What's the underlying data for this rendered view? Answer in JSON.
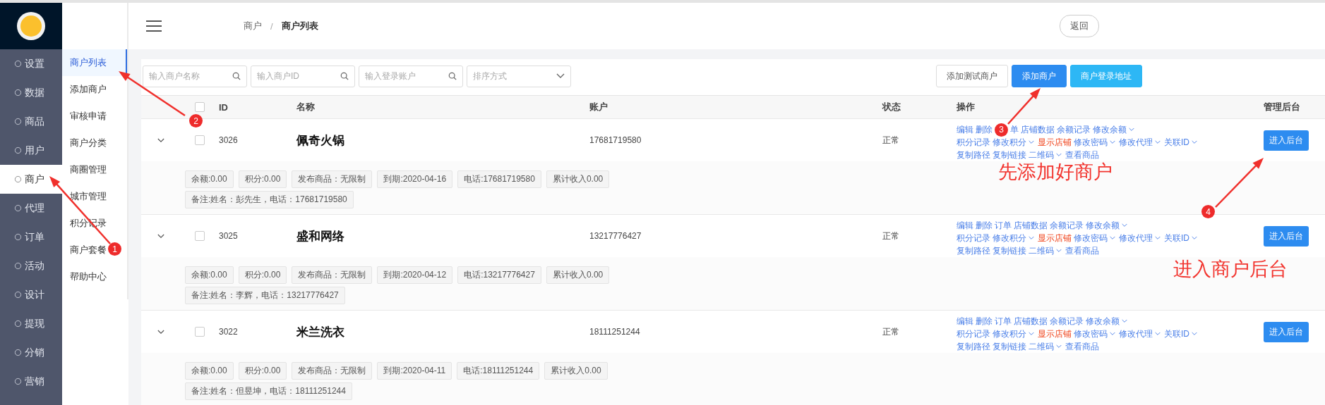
{
  "sidebar": {
    "items": [
      {
        "label": "设置",
        "selected": false
      },
      {
        "label": "数据",
        "selected": false
      },
      {
        "label": "商品",
        "selected": false
      },
      {
        "label": "用户",
        "selected": false
      },
      {
        "label": "商户",
        "selected": true
      },
      {
        "label": "代理",
        "selected": false
      },
      {
        "label": "订单",
        "selected": false
      },
      {
        "label": "活动",
        "selected": false
      },
      {
        "label": "设计",
        "selected": false
      },
      {
        "label": "提现",
        "selected": false
      },
      {
        "label": "分销",
        "selected": false
      },
      {
        "label": "营销",
        "selected": false
      }
    ]
  },
  "submenu": {
    "items": [
      {
        "label": "商户列表",
        "selected": true
      },
      {
        "label": "添加商户",
        "selected": false
      },
      {
        "label": "审核申请",
        "selected": false
      },
      {
        "label": "商户分类",
        "selected": false
      },
      {
        "label": "商圈管理",
        "selected": false
      },
      {
        "label": "城市管理",
        "selected": false
      },
      {
        "label": "积分记录",
        "selected": false
      },
      {
        "label": "商户套餐",
        "selected": false
      },
      {
        "label": "帮助中心",
        "selected": false
      }
    ]
  },
  "header": {
    "breadcrumb": [
      "商户",
      "商户列表"
    ],
    "separator": "/",
    "back_button": "返回"
  },
  "filters": [
    {
      "placeholder": "输入商户名称",
      "kind": "search"
    },
    {
      "placeholder": "输入商户ID",
      "kind": "search"
    },
    {
      "placeholder": "输入登录账户",
      "kind": "search"
    },
    {
      "placeholder": "排序方式",
      "kind": "select"
    }
  ],
  "toolbar_buttons": [
    {
      "label": "添加测试商户",
      "kind": "default"
    },
    {
      "label": "添加商户",
      "kind": "primary"
    },
    {
      "label": "商户登录地址",
      "kind": "info"
    }
  ],
  "table": {
    "columns": [
      "ID",
      "名称",
      "账户",
      "状态",
      "操作",
      "管理后台"
    ],
    "select_all_checked": false,
    "rows": [
      {
        "expanded": true,
        "checked": false,
        "id": "3026",
        "name": "佩奇火锅",
        "account": "17681719580",
        "status": "正常",
        "admin_button": "进入后台",
        "actions": [
          [
            {
              "kind": "link",
              "text": "编辑",
              "dropdown": false,
              "highlight": false
            },
            {
              "kind": "link",
              "text": "删除",
              "dropdown": false,
              "highlight": false
            },
            {
              "kind": "marker",
              "text": "3"
            },
            {
              "kind": "link",
              "text": "单",
              "dropdown": false,
              "highlight": false
            },
            {
              "kind": "link",
              "text": "店铺数据",
              "dropdown": false,
              "highlight": false
            },
            {
              "kind": "link",
              "text": "余额记录",
              "dropdown": false,
              "highlight": false
            },
            {
              "kind": "link",
              "text": "修改余额",
              "dropdown": true,
              "highlight": false
            }
          ],
          [
            {
              "kind": "link",
              "text": "积分记录",
              "dropdown": false,
              "highlight": false
            },
            {
              "kind": "link",
              "text": "修改积分",
              "dropdown": true,
              "highlight": false
            },
            {
              "kind": "link",
              "text": "显示店铺",
              "dropdown": false,
              "highlight": true
            },
            {
              "kind": "link",
              "text": "修改密码",
              "dropdown": true,
              "highlight": false
            },
            {
              "kind": "link",
              "text": "修改代理",
              "dropdown": true,
              "highlight": false
            },
            {
              "kind": "link",
              "text": "关联ID",
              "dropdown": true,
              "highlight": false
            }
          ],
          [
            {
              "kind": "link",
              "text": "复制路径",
              "dropdown": false,
              "highlight": false
            },
            {
              "kind": "link",
              "text": "复制链接",
              "dropdown": false,
              "highlight": false
            },
            {
              "kind": "link",
              "text": "二维码",
              "dropdown": true,
              "highlight": false
            },
            {
              "kind": "link",
              "text": "查看商品",
              "dropdown": false,
              "highlight": false
            }
          ]
        ],
        "tags": [
          "余额:0.00",
          "积分:0.00",
          "发布商品：无限制",
          "到期:2020-04-16",
          "电话:17681719580",
          "累计收入0.00"
        ],
        "remark": "备注:姓名：彭先生，电话：17681719580"
      },
      {
        "expanded": true,
        "checked": false,
        "id": "3025",
        "name": "盛和网络",
        "account": "13217776427",
        "status": "正常",
        "admin_button": "进入后台",
        "actions": [
          [
            {
              "kind": "link",
              "text": "编辑",
              "dropdown": false,
              "highlight": false
            },
            {
              "kind": "link",
              "text": "删除",
              "dropdown": false,
              "highlight": false
            },
            {
              "kind": "link",
              "text": "订单",
              "dropdown": false,
              "highlight": false
            },
            {
              "kind": "link",
              "text": "店铺数据",
              "dropdown": false,
              "highlight": false
            },
            {
              "kind": "link",
              "text": "余额记录",
              "dropdown": false,
              "highlight": false
            },
            {
              "kind": "link",
              "text": "修改余额",
              "dropdown": true,
              "highlight": false
            }
          ],
          [
            {
              "kind": "link",
              "text": "积分记录",
              "dropdown": false,
              "highlight": false
            },
            {
              "kind": "link",
              "text": "修改积分",
              "dropdown": true,
              "highlight": false
            },
            {
              "kind": "link",
              "text": "显示店铺",
              "dropdown": false,
              "highlight": true
            },
            {
              "kind": "link",
              "text": "修改密码",
              "dropdown": true,
              "highlight": false
            },
            {
              "kind": "link",
              "text": "修改代理",
              "dropdown": true,
              "highlight": false
            },
            {
              "kind": "link",
              "text": "关联ID",
              "dropdown": true,
              "highlight": false
            }
          ],
          [
            {
              "kind": "link",
              "text": "复制路径",
              "dropdown": false,
              "highlight": false
            },
            {
              "kind": "link",
              "text": "复制链接",
              "dropdown": false,
              "highlight": false
            },
            {
              "kind": "link",
              "text": "二维码",
              "dropdown": true,
              "highlight": false
            },
            {
              "kind": "link",
              "text": "查看商品",
              "dropdown": false,
              "highlight": false
            }
          ]
        ],
        "tags": [
          "余额:0.00",
          "积分:0.00",
          "发布商品：无限制",
          "到期:2020-04-12",
          "电话:13217776427",
          "累计收入0.00"
        ],
        "remark": "备注:姓名：李辉，电话：13217776427"
      },
      {
        "expanded": true,
        "checked": false,
        "id": "3022",
        "name": "米兰洗衣",
        "account": "18111251244",
        "status": "正常",
        "admin_button": "进入后台",
        "actions": [
          [
            {
              "kind": "link",
              "text": "编辑",
              "dropdown": false,
              "highlight": false
            },
            {
              "kind": "link",
              "text": "删除",
              "dropdown": false,
              "highlight": false
            },
            {
              "kind": "link",
              "text": "订单",
              "dropdown": false,
              "highlight": false
            },
            {
              "kind": "link",
              "text": "店铺数据",
              "dropdown": false,
              "highlight": false
            },
            {
              "kind": "link",
              "text": "余额记录",
              "dropdown": false,
              "highlight": false
            },
            {
              "kind": "link",
              "text": "修改余额",
              "dropdown": true,
              "highlight": false
            }
          ],
          [
            {
              "kind": "link",
              "text": "积分记录",
              "dropdown": false,
              "highlight": false
            },
            {
              "kind": "link",
              "text": "修改积分",
              "dropdown": true,
              "highlight": false
            },
            {
              "kind": "link",
              "text": "显示店铺",
              "dropdown": false,
              "highlight": true
            },
            {
              "kind": "link",
              "text": "修改密码",
              "dropdown": true,
              "highlight": false
            },
            {
              "kind": "link",
              "text": "修改代理",
              "dropdown": true,
              "highlight": false
            },
            {
              "kind": "link",
              "text": "关联ID",
              "dropdown": true,
              "highlight": false
            }
          ],
          [
            {
              "kind": "link",
              "text": "复制路径",
              "dropdown": false,
              "highlight": false
            },
            {
              "kind": "link",
              "text": "复制链接",
              "dropdown": false,
              "highlight": false
            },
            {
              "kind": "link",
              "text": "二维码",
              "dropdown": true,
              "highlight": false
            },
            {
              "kind": "link",
              "text": "查看商品",
              "dropdown": false,
              "highlight": false
            }
          ]
        ],
        "tags": [
          "余额:0.00",
          "积分:0.00",
          "发布商品：无限制",
          "到期:2020-04-11",
          "电话:18111251244",
          "累计收入0.00"
        ],
        "remark": "备注:姓名：但昱坤，电话：18111251244"
      }
    ]
  },
  "annotations": {
    "markers": [
      "1",
      "2",
      "4"
    ],
    "captions": [
      "先添加好商户",
      "进入商户后台"
    ]
  }
}
